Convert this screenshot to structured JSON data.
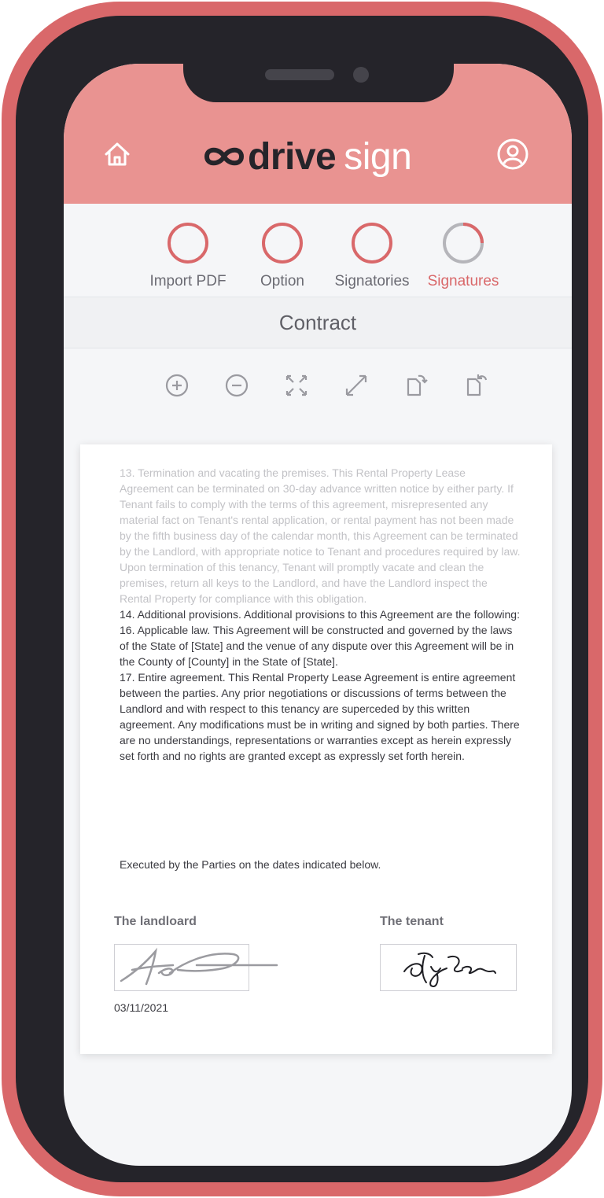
{
  "app": {
    "logo_bold": "drive",
    "logo_light": "sign",
    "brand_color": "#e99391",
    "accent_color": "#d9686a",
    "icons": {
      "home": "home-icon",
      "profile": "user-circle-icon"
    }
  },
  "steps": [
    {
      "label": "Import PDF",
      "state": "complete"
    },
    {
      "label": "Option",
      "state": "complete"
    },
    {
      "label": "Signatories",
      "state": "complete"
    },
    {
      "label": "Signatures",
      "state": "active",
      "progress": 0.25
    }
  ],
  "document": {
    "title": "Contract",
    "toolbar": [
      "zoom-in-icon",
      "zoom-out-icon",
      "fit-page-icon",
      "expand-icon",
      "rotate-right-icon",
      "rotate-left-icon"
    ],
    "paragraph_faded": "13. Termination and vacating the premises.  This Rental Property Lease Agreement can be terminated on 30-day advance written notice by either party.  If Tenant fails to comply with the terms of this agreement, misrepresented any material fact on Tenant's rental application, or rental payment has not been made by the fifth business day of the calendar month, this Agreement can be terminated by the Landlord, with appropriate notice to Tenant and procedures required by law.  Upon termination of this tenancy, Tenant will promptly vacate and clean the premises, return all keys to the Landlord, and have the Landlord inspect the Rental Property for compliance with this obligation.",
    "paragraph_14": "14. Additional provisions.  Additional provisions to this Agreement are the following:",
    "paragraph_16": "16. Applicable law.  This Agreement will be constructed and governed by the laws of the State of [State] and the venue of any dispute over this Agreement will be in the County of [County] in the State of [State].",
    "paragraph_17": "17. Entire agreement.  This Rental Property Lease Agreement is entire agreement between the parties.  Any prior negotiations or discussions of terms between the Landlord and with respect to this tenancy are superceded by this written agreement. Any modifications must be in writing and signed by both parties. There are no understandings, representations or warranties except as herein expressly set forth and no rights are granted except as expressly set forth herein.",
    "executed": "Executed by the Parties on the dates indicated below.",
    "landlord_label": "The landloard",
    "tenant_label": "The tenant",
    "landlord_date": "03/11/2021"
  }
}
